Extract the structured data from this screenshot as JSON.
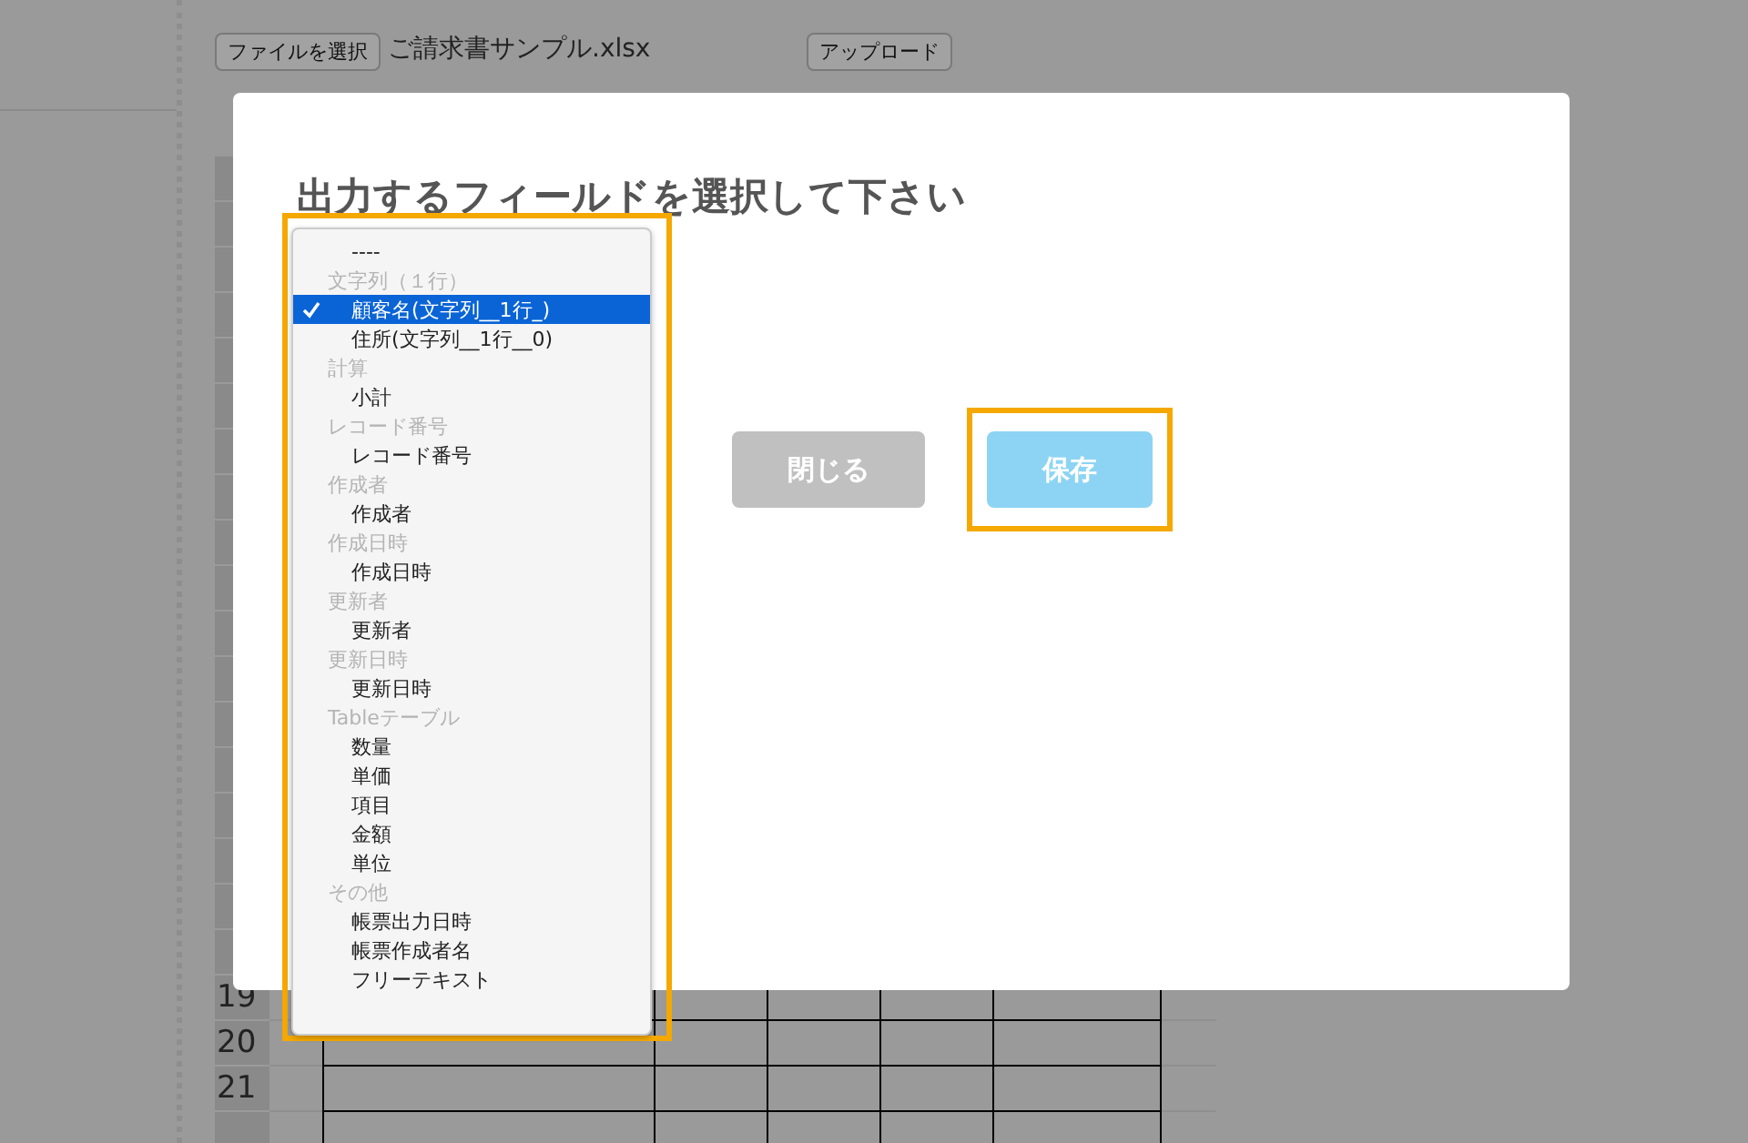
{
  "background": {
    "file_button": "ファイルを選択",
    "file_name": "ご請求書サンプル.xlsx",
    "upload_button": "アップロード",
    "sheet": {
      "row_numbers": [
        "19",
        "20",
        "21"
      ]
    }
  },
  "dialog": {
    "title": "出力するフィールドを選択して下さい",
    "field_list": {
      "highlighted": true,
      "items": [
        {
          "kind": "option",
          "label": "----",
          "selected": false
        },
        {
          "kind": "group",
          "label": "文字列（１行）"
        },
        {
          "kind": "option",
          "label": "顧客名(文字列__1行_)",
          "selected": true
        },
        {
          "kind": "option",
          "label": "住所(文字列__1行__0)",
          "selected": false
        },
        {
          "kind": "group",
          "label": "計算"
        },
        {
          "kind": "option",
          "label": "小計",
          "selected": false
        },
        {
          "kind": "group",
          "label": "レコード番号"
        },
        {
          "kind": "option",
          "label": "レコード番号",
          "selected": false
        },
        {
          "kind": "group",
          "label": "作成者"
        },
        {
          "kind": "option",
          "label": "作成者",
          "selected": false
        },
        {
          "kind": "group",
          "label": "作成日時"
        },
        {
          "kind": "option",
          "label": "作成日時",
          "selected": false
        },
        {
          "kind": "group",
          "label": "更新者"
        },
        {
          "kind": "option",
          "label": "更新者",
          "selected": false
        },
        {
          "kind": "group",
          "label": "更新日時"
        },
        {
          "kind": "option",
          "label": "更新日時",
          "selected": false
        },
        {
          "kind": "group",
          "label": "Tableテーブル"
        },
        {
          "kind": "option",
          "label": "数量",
          "selected": false
        },
        {
          "kind": "option",
          "label": "単価",
          "selected": false
        },
        {
          "kind": "option",
          "label": "項目",
          "selected": false
        },
        {
          "kind": "option",
          "label": "金額",
          "selected": false
        },
        {
          "kind": "option",
          "label": "単位",
          "selected": false
        },
        {
          "kind": "group",
          "label": "その他"
        },
        {
          "kind": "option",
          "label": "帳票出力日時",
          "selected": false
        },
        {
          "kind": "option",
          "label": "帳票作成者名",
          "selected": false
        },
        {
          "kind": "option",
          "label": "フリーテキスト",
          "selected": false
        }
      ]
    },
    "buttons": [
      {
        "kind": "close",
        "label": "閉じる",
        "highlighted": false
      },
      {
        "kind": "save",
        "label": "保存",
        "highlighted": true
      }
    ]
  }
}
